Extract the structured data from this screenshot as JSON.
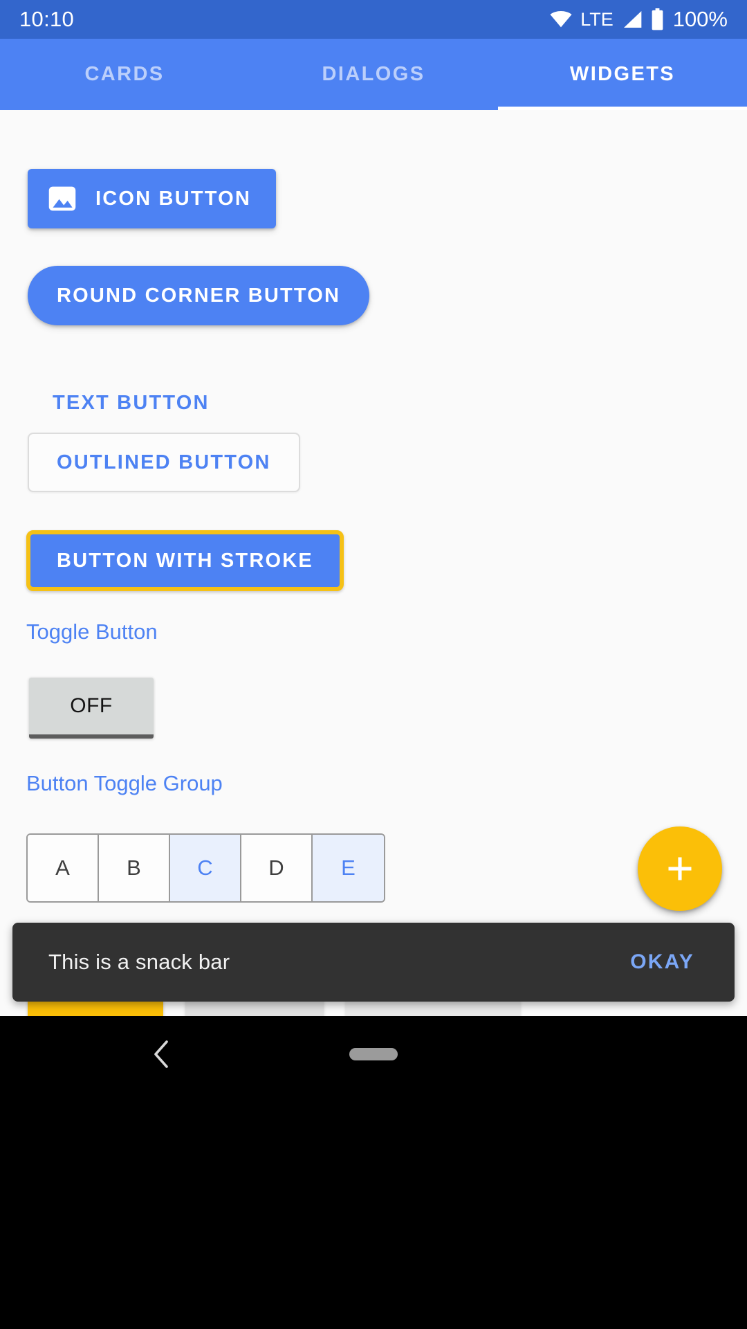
{
  "status_bar": {
    "time": "10:10",
    "network_label": "LTE",
    "battery_percent": "100%",
    "icons": [
      "wifi-icon",
      "signal-icon",
      "battery-icon"
    ],
    "background_color": "#3366cc"
  },
  "tabs": {
    "items": [
      {
        "label": "CARDS",
        "active": false
      },
      {
        "label": "DIALOGS",
        "active": false
      },
      {
        "label": "WIDGETS",
        "active": true
      }
    ],
    "background_color": "#4d82f3",
    "indicator_color": "#ffffff"
  },
  "widgets": {
    "icon_button": {
      "label": "ICON BUTTON",
      "icon": "image-icon",
      "color": "#4d82f3"
    },
    "round_corner_button": {
      "label": "ROUND CORNER BUTTON",
      "color": "#4d82f3"
    },
    "text_button": {
      "label": "TEXT BUTTON",
      "color": "#4d82f3"
    },
    "outlined_button": {
      "label": "OUTLINED BUTTON",
      "text_color": "#4d82f3",
      "border_color": "#dcdcdc"
    },
    "stroke_button": {
      "label": "BUTTON WITH STROKE",
      "fill_color": "#4d82f3",
      "stroke_color": "#f5c116"
    },
    "toggle_button": {
      "section_label": "Toggle Button",
      "state_label": "OFF",
      "background_color": "#d6d9d8",
      "underline_color": "#5d5d5d"
    },
    "toggle_group": {
      "section_label": "Button Toggle Group",
      "items": [
        {
          "label": "A",
          "selected": false
        },
        {
          "label": "B",
          "selected": false
        },
        {
          "label": "C",
          "selected": true
        },
        {
          "label": "D",
          "selected": false
        },
        {
          "label": "E",
          "selected": true
        }
      ],
      "selected_background": "#e9f0fd",
      "selected_text_color": "#4d82f3"
    },
    "fab": {
      "icon": "plus-icon",
      "color": "#fbbf08"
    }
  },
  "snackbar": {
    "message": "This is a snack bar",
    "action_label": "OKAY",
    "background_color": "#323232",
    "action_color": "#7ba7f6"
  },
  "navigation_bar": {
    "back_icon": "chevron-left-icon",
    "home_indicator": "home-pill",
    "background_color": "#000000"
  }
}
